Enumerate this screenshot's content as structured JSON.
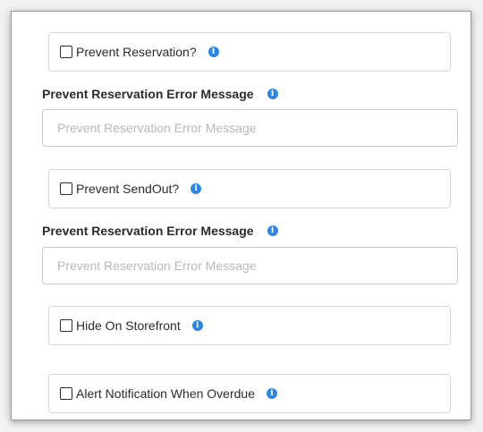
{
  "options": {
    "prevent_reservation": {
      "label": "Prevent Reservation?",
      "checked": false
    },
    "prevent_sendout": {
      "label": "Prevent SendOut?",
      "checked": false
    },
    "hide_on_storefront": {
      "label": "Hide On Storefront",
      "checked": false
    },
    "alert_overdue": {
      "label": "Alert Notification When Overdue",
      "checked": false
    }
  },
  "fields": {
    "reservation_error": {
      "label": "Prevent Reservation Error Message",
      "placeholder": "Prevent Reservation Error Message",
      "value": ""
    },
    "sendout_error": {
      "label": "Prevent Reservation Error Message",
      "placeholder": "Prevent Reservation Error Message",
      "value": ""
    }
  },
  "info_glyph": "i",
  "colors": {
    "info_icon": "#2e86de",
    "border": "#d6d6d6",
    "placeholder": "#b8b8b8"
  }
}
